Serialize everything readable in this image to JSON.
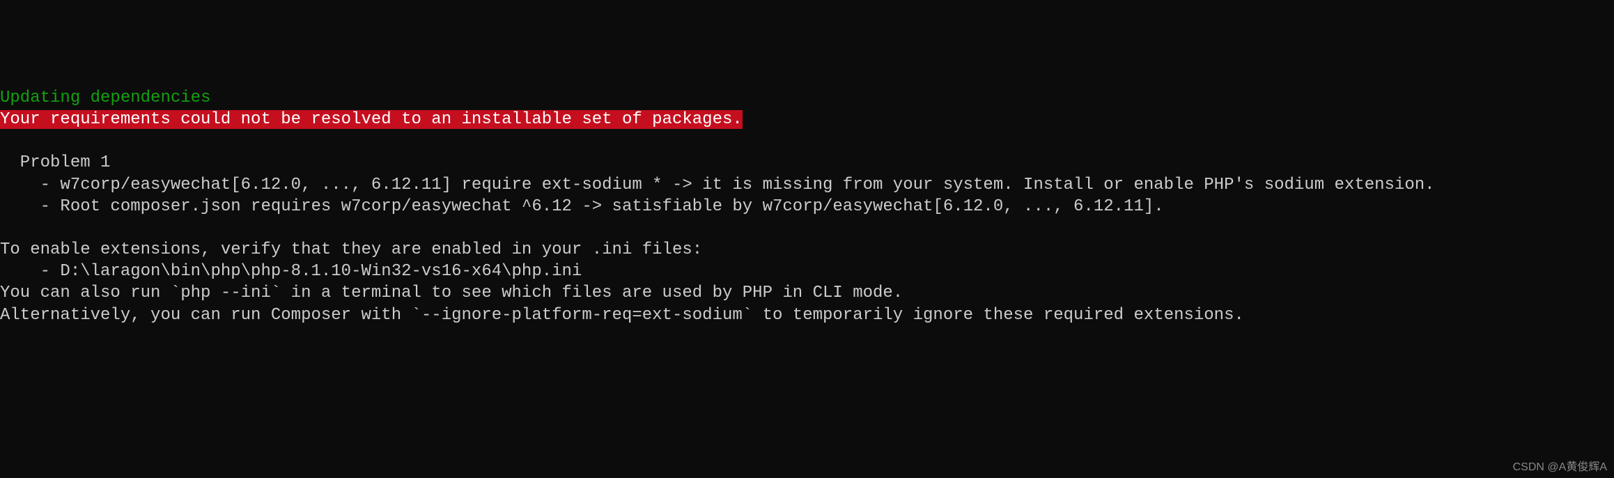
{
  "terminal": {
    "line_updating": "Updating dependencies",
    "line_error": "Your requirements could not be resolved to an installable set of packages.",
    "line_blank1": "",
    "line_problem_header": "  Problem 1",
    "line_problem_item1": "    - w7corp/easywechat[6.12.0, ..., 6.12.11] require ext-sodium * -> it is missing from your system. Install or enable PHP's sodium extension.",
    "line_problem_item2": "    - Root composer.json requires w7corp/easywechat ^6.12 -> satisfiable by w7corp/easywechat[6.12.0, ..., 6.12.11].",
    "line_blank2": "",
    "line_enable_ext": "To enable extensions, verify that they are enabled in your .ini files:",
    "line_ini_path": "    - D:\\laragon\\bin\\php\\php-8.1.10-Win32-vs16-x64\\php.ini",
    "line_php_ini_hint": "You can also run `php --ini` in a terminal to see which files are used by PHP in CLI mode.",
    "line_alternative": "Alternatively, you can run Composer with `--ignore-platform-req=ext-sodium` to temporarily ignore these required extensions."
  },
  "watermark": "CSDN @A黄俊辉A"
}
